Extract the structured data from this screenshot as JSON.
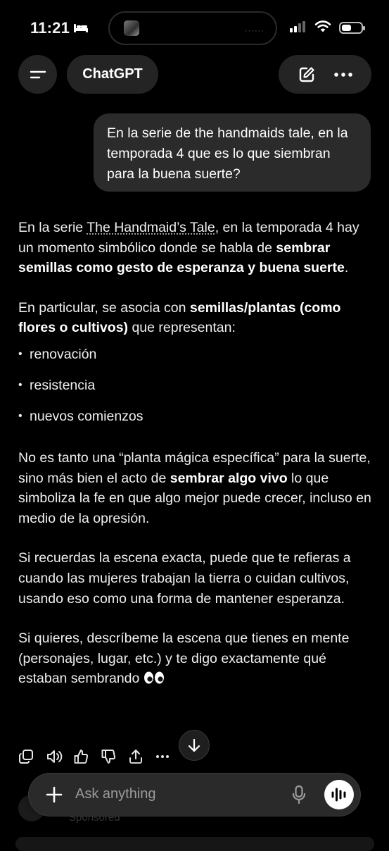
{
  "status_bar": {
    "time": "11:21"
  },
  "header": {
    "title": "ChatGPT"
  },
  "user_message": "En la serie de the handmaids tale, en la temporada 4 que es lo que siembran para la buena suerte?",
  "answer": {
    "p1_a": "En la serie ",
    "p1_link": "The Handmaid’s Tale",
    "p1_b": ", en la temporada 4 hay un momento simbólico donde se habla de ",
    "p1_bold": "sembrar semillas como gesto de esperanza y buena suerte",
    "p1_c": ".",
    "p2_a": "En particular, se asocia con ",
    "p2_bold": "semillas/plantas (como flores o cultivos)",
    "p2_b": " que representan:",
    "bullets": [
      "renovación",
      "resistencia",
      "nuevos comienzos"
    ],
    "p3_a": "No es tanto una “planta mágica específica” para la suerte, sino más bien el acto de ",
    "p3_bold": "sembrar algo vivo",
    "p3_b": " lo que simboliza la fe en que algo mejor puede crecer, incluso en medio de la opresión.",
    "p4": "Si recuerdas la escena exacta, puede que te refieras a cuando las mujeres trabajan la tierra o cuidan cultivos, usando eso como una forma de mantener esperanza.",
    "p5": "Si quieres, descríbeme la escena que tienes en mente (personajes, lugar, etc.) y te digo exactamente qué estaban sembrando"
  },
  "response_tools": [
    "copy-icon",
    "read-aloud-icon",
    "thumbs-up-icon",
    "thumbs-down-icon",
    "share-icon",
    "more-icon"
  ],
  "sponsored_label": "Sponsored",
  "composer": {
    "placeholder": "Ask anything"
  }
}
